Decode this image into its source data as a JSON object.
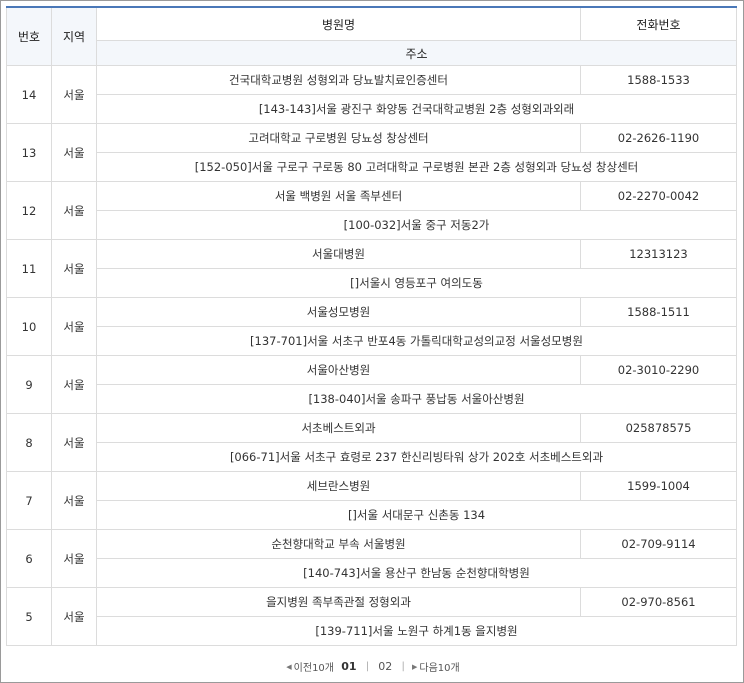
{
  "header": {
    "no": "번호",
    "region": "지역",
    "name": "병원명",
    "phone": "전화번호",
    "address": "주소"
  },
  "rows": [
    {
      "no": "14",
      "region": "서울",
      "name": "건국대학교병원 성형외과 당뇨발치료인증센터",
      "phone": "1588-1533",
      "address": "[143-143]서울 광진구 화양동 건국대학교병원 2층 성형외과외래"
    },
    {
      "no": "13",
      "region": "서울",
      "name": "고려대학교 구로병원 당뇨성 창상센터",
      "phone": "02-2626-1190",
      "address": "[152-050]서울 구로구 구로동 80 고려대학교 구로병원 본관 2층 성형외과 당뇨성 창상센터"
    },
    {
      "no": "12",
      "region": "서울",
      "name": "서울 백병원 서울 족부센터",
      "phone": "02-2270-0042",
      "address": "[100-032]서울 중구 저동2가"
    },
    {
      "no": "11",
      "region": "서울",
      "name": "서울대병원",
      "phone": "12313123",
      "address": "[]서울시 영등포구 여의도동"
    },
    {
      "no": "10",
      "region": "서울",
      "name": "서울성모병원",
      "phone": "1588-1511",
      "address": "[137-701]서울 서초구 반포4동 가톨릭대학교성의교정 서울성모병원"
    },
    {
      "no": "9",
      "region": "서울",
      "name": "서울아산병원",
      "phone": "02-3010-2290",
      "address": "[138-040]서울 송파구 풍납동 서울아산병원"
    },
    {
      "no": "8",
      "region": "서울",
      "name": "서초베스트외과",
      "phone": "025878575",
      "address": "[066-71]서울 서초구 효령로 237 한신리빙타워 상가 202호 서초베스트외과"
    },
    {
      "no": "7",
      "region": "서울",
      "name": "세브란스병원",
      "phone": "1599-1004",
      "address": "[]서울 서대문구 신촌동 134"
    },
    {
      "no": "6",
      "region": "서울",
      "name": "순천향대학교 부속 서울병원",
      "phone": "02-709-9114",
      "address": "[140-743]서울 용산구 한남동 순천향대학병원"
    },
    {
      "no": "5",
      "region": "서울",
      "name": "을지병원 족부족관절 정형외과",
      "phone": "02-970-8561",
      "address": "[139-711]서울 노원구 하계1동 을지병원"
    }
  ],
  "pager": {
    "prev": "이전10개",
    "current": "01",
    "page2": "02",
    "next": "다음10개"
  }
}
